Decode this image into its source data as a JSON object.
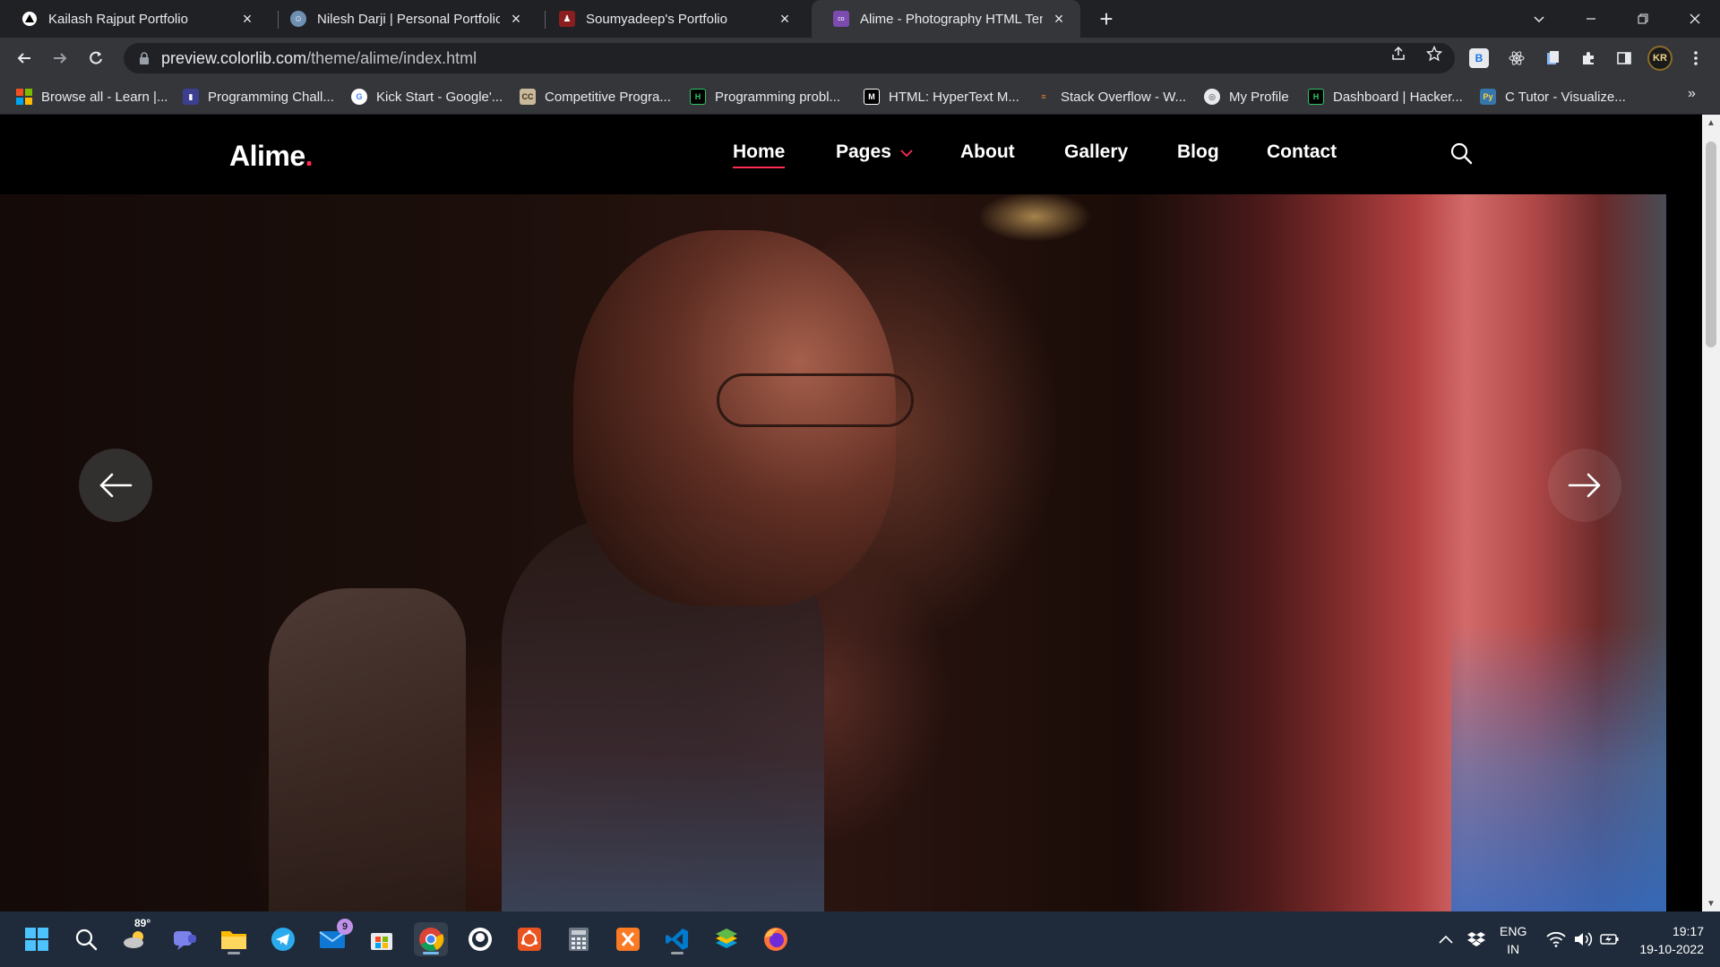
{
  "browser": {
    "tabs": [
      {
        "title": "Kailash Rajput Portfolio",
        "favicon": "triangle-logo-icon"
      },
      {
        "title": "Nilesh Darji | Personal Portfolio",
        "favicon": "avatar-icon"
      },
      {
        "title": "Soumyadeep's Portfolio",
        "favicon": "person-icon"
      },
      {
        "title": "Alime - Photography HTML Temp",
        "favicon": "colorlib-icon",
        "active": true
      }
    ],
    "url_host": "preview.colorlib.com",
    "url_path": "/theme/alime/index.html",
    "profile_initials": "KR",
    "bookmarks": [
      "Browse all - Learn |...",
      "Programming Chall...",
      "Kick Start - Google'...",
      "Competitive Progra...",
      "Programming probl...",
      "HTML: HyperText M...",
      "Stack Overflow - W...",
      "My Profile",
      "Dashboard | Hacker...",
      "C Tutor - Visualize..."
    ]
  },
  "site": {
    "logo_text": "Alime",
    "logo_dot": ".",
    "nav": {
      "home": "Home",
      "pages": "Pages",
      "about": "About",
      "gallery": "Gallery",
      "blog": "Blog",
      "contact": "Contact"
    },
    "accent_color": "#ff2d55"
  },
  "taskbar": {
    "weather_temp": "89°",
    "mail_badge": "9",
    "lang_line1": "ENG",
    "lang_line2": "IN",
    "time": "19:17",
    "date": "19-10-2022"
  }
}
